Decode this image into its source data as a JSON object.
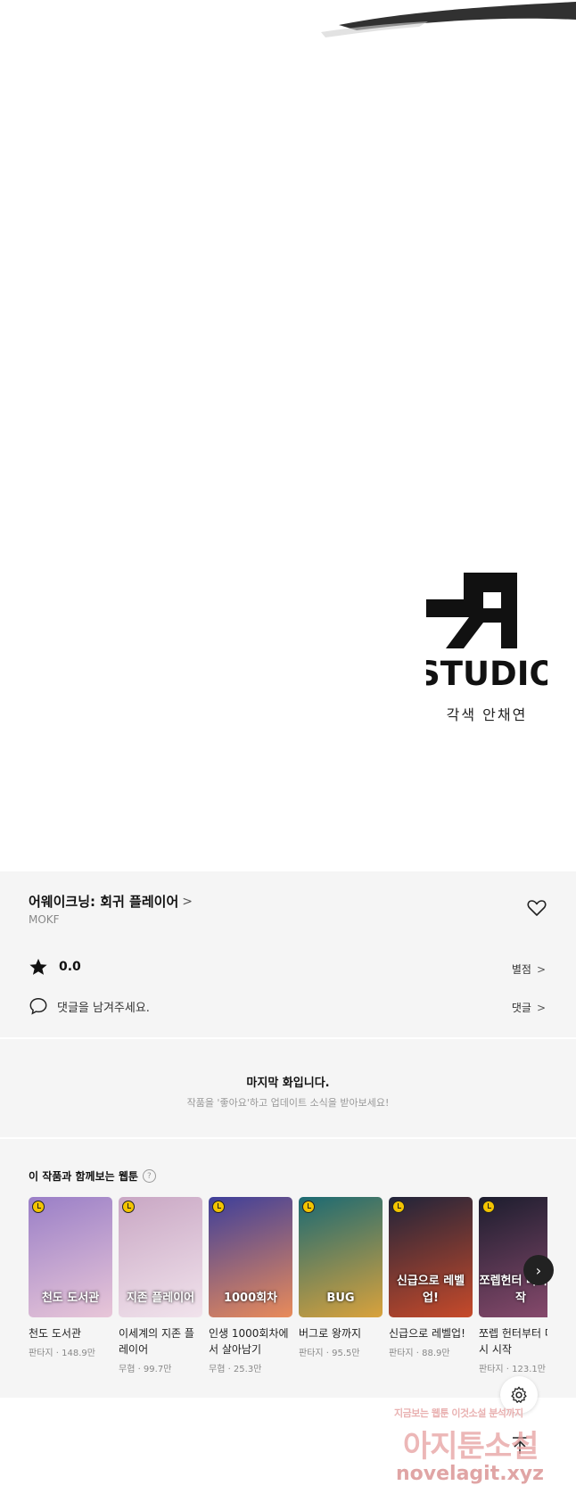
{
  "studio": {
    "credit": "각색 안채연",
    "logo_text": "STUDIO"
  },
  "info": {
    "title": "어웨이크닝: 회귀 플레이어",
    "title_chevron": ">",
    "author": "MOKF",
    "score": "0.0",
    "rating_link": "별점",
    "comment_prompt": "댓글을 남겨주세요.",
    "comment_link": "댓글",
    "chevron": ">"
  },
  "last_episode": {
    "title": "마지막 화입니다.",
    "subtitle": "작품을 '좋아요'하고 업데이트 소식을 받아보세요!"
  },
  "recommend": {
    "title": "이 작품과 함께보는 웹툰",
    "help": "?",
    "next": "›",
    "items": [
      {
        "name": "천도 도서관",
        "meta": "판타지 · 148.9만",
        "cover_text": "천도 도서관",
        "color_a": "#9a7fc7",
        "color_b": "#e8c6d8"
      },
      {
        "name": "이세계의 지존 플레이어",
        "meta": "무협 · 99.7만",
        "cover_text": "지존 플레이어",
        "color_a": "#c9a7c4",
        "color_b": "#f1e3ec"
      },
      {
        "name": "인생 1000회차에서 살아남기",
        "meta": "무협 · 25.3만",
        "cover_text": "1000회차",
        "color_a": "#3e3f9a",
        "color_b": "#e98b5a"
      },
      {
        "name": "버그로 왕까지",
        "meta": "판타지 · 95.5만",
        "cover_text": "BUG",
        "color_a": "#1b6a73",
        "color_b": "#d9a23c"
      },
      {
        "name": "신급으로 레벨업!",
        "meta": "판타지 · 88.9만",
        "cover_text": "신급으로 레벨업!",
        "color_a": "#20243a",
        "color_b": "#c74a2a"
      },
      {
        "name": "쪼렙 헌터부터 다시 시작",
        "meta": "판타지 · 123.1만",
        "cover_text": "쪼렙헌터 다시 시작",
        "color_a": "#1c1d2e",
        "color_b": "#8a4b6e"
      }
    ]
  },
  "watermark": {
    "line1": "지금보는 웹툰 이것소설 분석까지",
    "line2": "아지툰소설",
    "line3": "novelagit.xyz"
  },
  "colors": {
    "panel_bg": "#f5f5f5",
    "accent_badge": "#f3c400"
  }
}
